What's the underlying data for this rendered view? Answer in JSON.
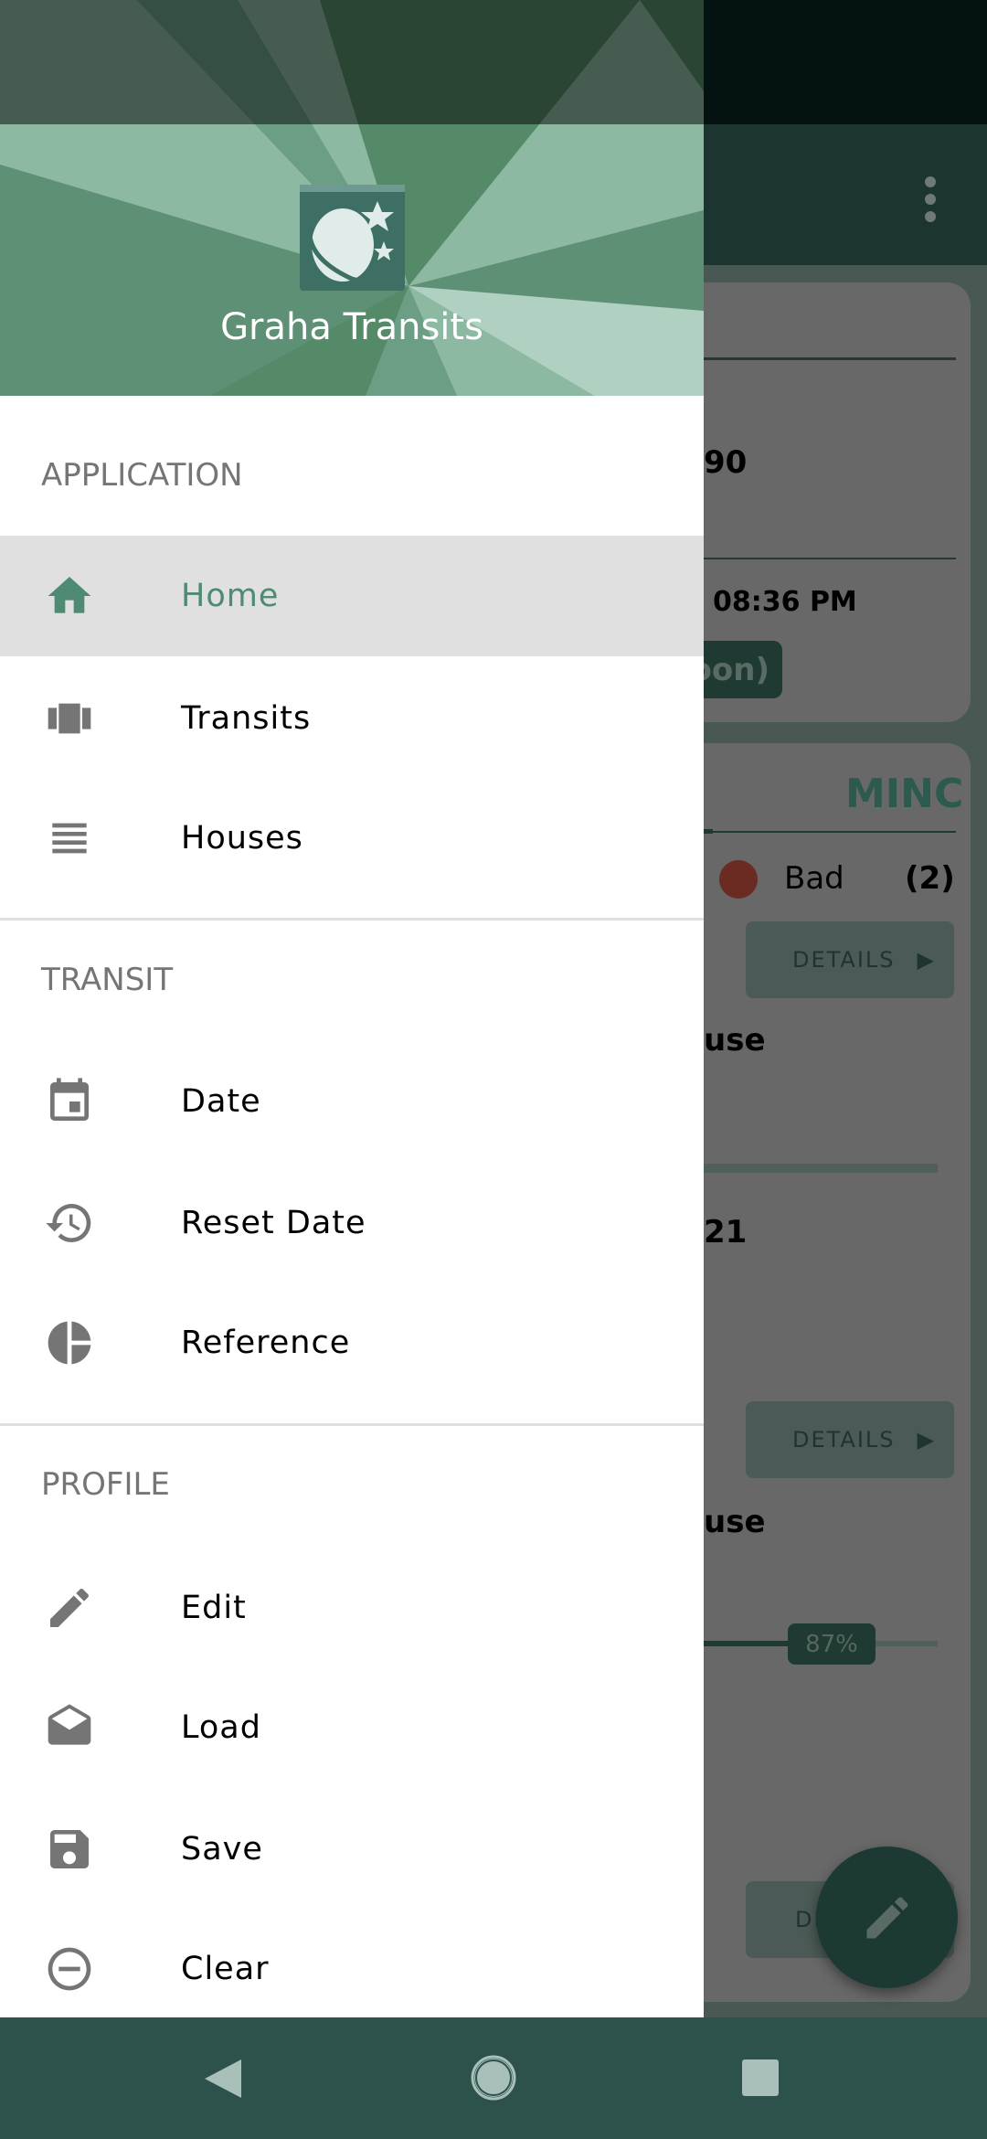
{
  "app": {
    "title": "Graha Transits",
    "accent": "#4f8a72",
    "nav_bar_color": "#2d524b"
  },
  "background": {
    "card1": {
      "value_fragment": "90",
      "time_fragment": "08:36 PM",
      "pill_fragment": "oon)"
    },
    "card2": {
      "tab_fragment": "MINC",
      "legend": {
        "label": "Bad",
        "count": "(2)",
        "color": "#c0392b"
      },
      "rows": [
        {
          "details_label": "DETAILS",
          "house_fragment": "use",
          "number_fragment": "21"
        },
        {
          "details_label": "DETAILS",
          "house_fragment": "use",
          "progress_label": "87%",
          "progress": 87
        },
        {
          "details_label": "DE"
        }
      ]
    },
    "fab_icon": "pencil-icon",
    "menu_icon": "more-vert-icon"
  },
  "drawer": {
    "sections": [
      {
        "title": "APPLICATION",
        "items": [
          {
            "label": "Home",
            "icon": "home-icon",
            "active": true
          },
          {
            "label": "Transits",
            "icon": "carousel-icon"
          },
          {
            "label": "Houses",
            "icon": "list-icon"
          }
        ]
      },
      {
        "title": "TRANSIT",
        "items": [
          {
            "label": "Date",
            "icon": "calendar-icon"
          },
          {
            "label": "Reset Date",
            "icon": "history-icon"
          },
          {
            "label": "Reference",
            "icon": "pie-chart-icon"
          }
        ]
      },
      {
        "title": "PROFILE",
        "items": [
          {
            "label": "Edit",
            "icon": "pencil-icon"
          },
          {
            "label": "Load",
            "icon": "open-mail-icon"
          },
          {
            "label": "Save",
            "icon": "floppy-disk-icon"
          },
          {
            "label": "Clear",
            "icon": "minus-circle-icon"
          }
        ]
      }
    ]
  },
  "navbar": {
    "back": "back-icon",
    "home": "home-circle-icon",
    "recents": "recents-icon"
  }
}
